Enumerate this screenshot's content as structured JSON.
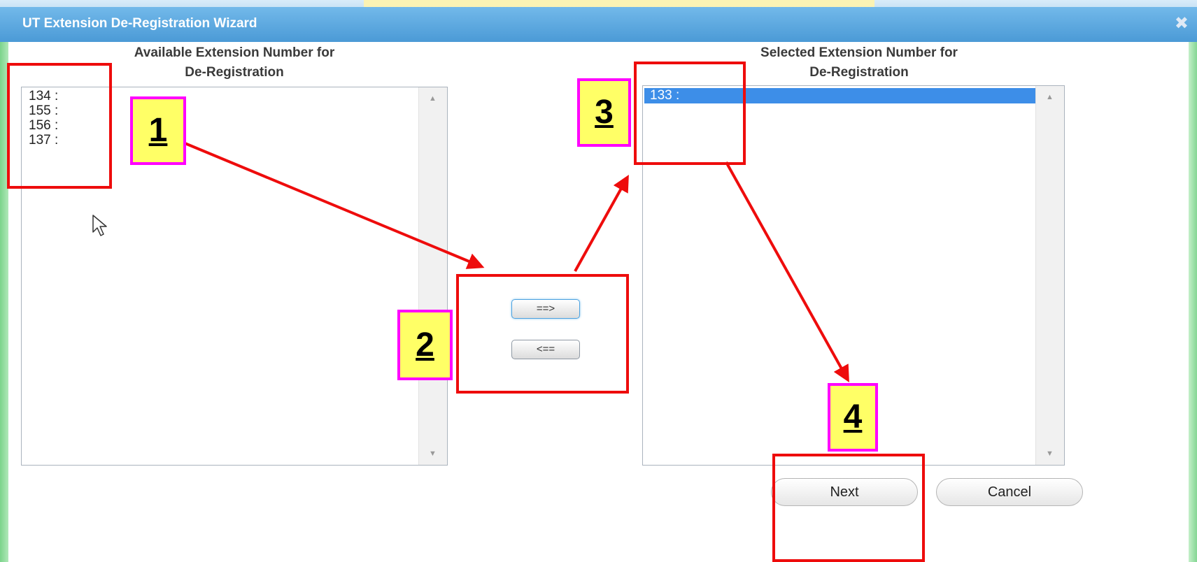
{
  "window": {
    "title": "UT Extension De-Registration Wizard",
    "close_icon": "close-icon"
  },
  "available_list": {
    "header_line1": "Available Extension Number for",
    "header_line2": "De-Registration",
    "items": [
      "134 :",
      "155 :",
      "156 :",
      "137 :"
    ]
  },
  "selected_list": {
    "header_line1": "Selected Extension Number for",
    "header_line2": "De-Registration",
    "items": [
      "133 :"
    ],
    "selected_index": 0
  },
  "move_buttons": {
    "add_label": "==>",
    "remove_label": "<=="
  },
  "footer": {
    "next_label": "Next",
    "cancel_label": "Cancel"
  },
  "annotations": {
    "step1": "1",
    "step2": "2",
    "step3": "3",
    "step4": "4",
    "box_color": "#ee0c0c",
    "callout_border": "#ff00ff",
    "callout_fill": "#ffff66"
  }
}
